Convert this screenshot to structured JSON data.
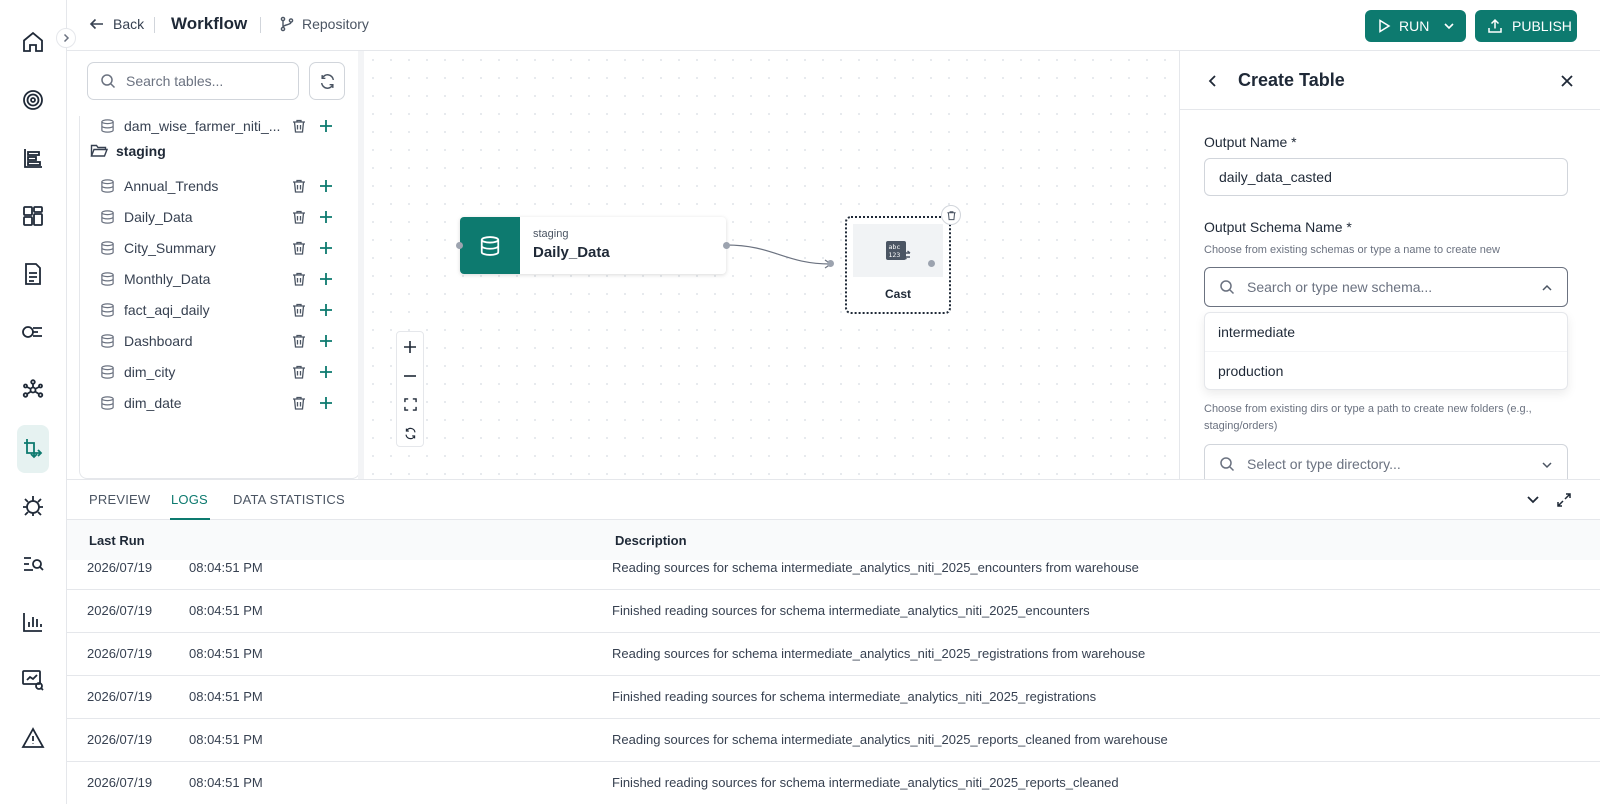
{
  "nav": {
    "icons": [
      "home-icon",
      "target-icon",
      "list-chart-icon",
      "dashboard-icon",
      "document-icon",
      "pipeline-icon",
      "network-icon",
      "transform-icon",
      "bug-icon",
      "search-list-icon",
      "bar-chart-icon",
      "monitor-chart-icon",
      "warning-icon"
    ],
    "active": "transform-icon"
  },
  "header": {
    "back_label": "Back",
    "title": "Workflow",
    "repo_label": "Repository",
    "run_label": "RUN",
    "publish_label": "PUBLISH"
  },
  "tables": {
    "search_placeholder": "Search tables...",
    "top_item": "dam_wise_farmer_niti_...",
    "folder": "staging",
    "items": [
      "Annual_Trends",
      "Daily_Data",
      "City_Summary",
      "Monthly_Data",
      "fact_aqi_daily",
      "Dashboard",
      "dim_city",
      "dim_date"
    ]
  },
  "canvas": {
    "source_node": {
      "schema": "staging",
      "name": "Daily_Data"
    },
    "cast_node": {
      "label": "Cast"
    }
  },
  "create_table": {
    "title": "Create Table",
    "output_name_label": "Output Name *",
    "output_name_value": "daily_data_casted",
    "schema_label": "Output Schema Name *",
    "schema_help": "Choose from existing schemas or type a name to create new",
    "schema_placeholder": "Search or type new schema...",
    "schema_options": [
      "intermediate",
      "production"
    ],
    "dir_help": "Choose from existing dirs or type a path to create new folders (e.g., staging/orders)",
    "dir_placeholder": "Select or type directory..."
  },
  "bottom": {
    "tabs": [
      "PREVIEW",
      "LOGS",
      "DATA STATISTICS"
    ],
    "active_tab": "LOGS",
    "columns": {
      "last_run": "Last Run",
      "description": "Description"
    },
    "rows": [
      {
        "date": "2026/07/19",
        "time": "08:04:51 PM",
        "description": "Reading sources for schema intermediate_analytics_niti_2025_encounters from warehouse"
      },
      {
        "date": "2026/07/19",
        "time": "08:04:51 PM",
        "description": "Finished reading sources for schema intermediate_analytics_niti_2025_encounters"
      },
      {
        "date": "2026/07/19",
        "time": "08:04:51 PM",
        "description": "Reading sources for schema intermediate_analytics_niti_2025_registrations from warehouse"
      },
      {
        "date": "2026/07/19",
        "time": "08:04:51 PM",
        "description": "Finished reading sources for schema intermediate_analytics_niti_2025_registrations"
      },
      {
        "date": "2026/07/19",
        "time": "08:04:51 PM",
        "description": "Reading sources for schema intermediate_analytics_niti_2025_reports_cleaned from warehouse"
      },
      {
        "date": "2026/07/19",
        "time": "08:04:51 PM",
        "description": "Finished reading sources for schema intermediate_analytics_niti_2025_reports_cleaned"
      }
    ]
  },
  "colors": {
    "accent": "#0d7a6f",
    "accent_soft": "#e6f2f1"
  }
}
